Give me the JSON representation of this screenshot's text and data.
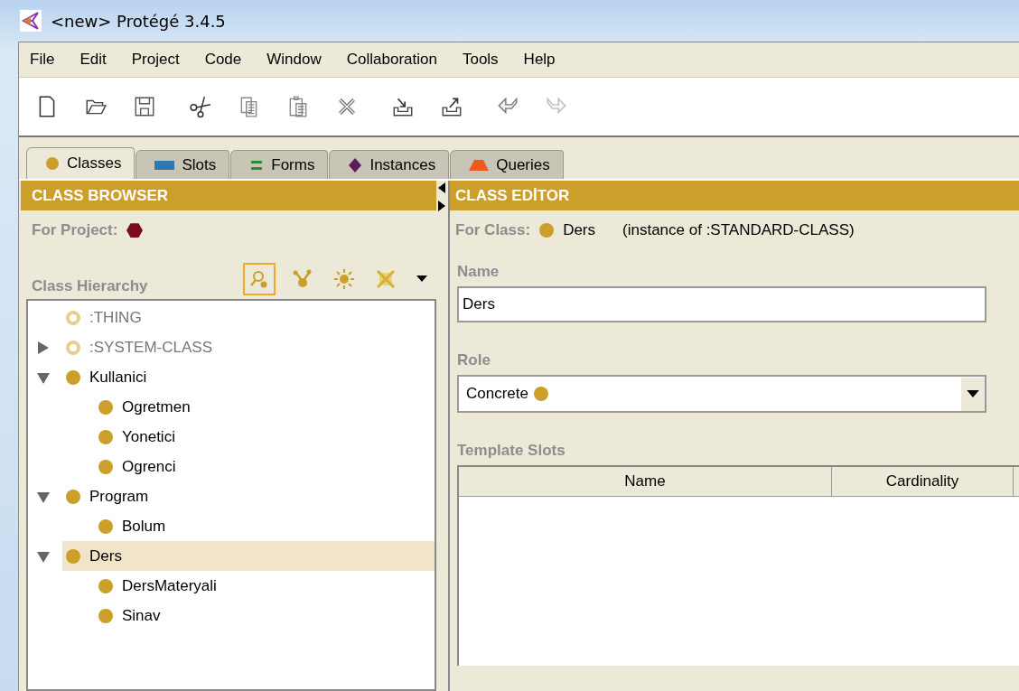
{
  "window": {
    "title": "<new>  Protégé 3.4.5"
  },
  "menu": [
    "File",
    "Edit",
    "Project",
    "Code",
    "Window",
    "Collaboration",
    "Tools",
    "Help"
  ],
  "tabs": [
    {
      "label": "Classes",
      "kind": "circle",
      "color": "#cc9e2a",
      "selected": true
    },
    {
      "label": "Slots",
      "kind": "bar",
      "color": "#2e78b0",
      "selected": false
    },
    {
      "label": "Forms",
      "kind": "lines",
      "color": "#2e8a2e",
      "selected": false
    },
    {
      "label": "Instances",
      "kind": "diamond",
      "color": "#5a1e5a",
      "selected": false
    },
    {
      "label": "Queries",
      "kind": "trapezoid",
      "color": "#ef5a1e",
      "selected": false
    }
  ],
  "class_browser": {
    "title": "CLASS BROWSER",
    "for_project_label": "For Project:",
    "hierarchy_label": "Class Hierarchy",
    "tree": [
      {
        "label": ":THING",
        "kind": "system",
        "selected": false
      },
      {
        "label": ":SYSTEM-CLASS",
        "kind": "system",
        "expanded": false,
        "selected": false
      },
      {
        "label": "Kullanici",
        "kind": "class",
        "expanded": true,
        "selected": false,
        "children": [
          {
            "label": "Ogretmen",
            "kind": "class",
            "selected": false
          },
          {
            "label": "Yonetici",
            "kind": "class",
            "selected": false
          },
          {
            "label": "Ogrenci",
            "kind": "class",
            "selected": false
          }
        ]
      },
      {
        "label": "Program",
        "kind": "class",
        "expanded": true,
        "selected": false,
        "children": [
          {
            "label": "Bolum",
            "kind": "class",
            "selected": false
          }
        ]
      },
      {
        "label": "Ders",
        "kind": "class",
        "expanded": true,
        "selected": true,
        "children": [
          {
            "label": "DersMateryali",
            "kind": "class",
            "selected": false
          },
          {
            "label": "Sinav",
            "kind": "class",
            "selected": false
          }
        ]
      }
    ]
  },
  "class_editor": {
    "title": "CLASS EDİTOR",
    "for_class_label": "For Class:",
    "class_name": "Ders",
    "instance_of": "(instance of :STANDARD-CLASS)",
    "name_label": "Name",
    "name_value": "Ders",
    "role_label": "Role",
    "role_value": "Concrete",
    "template_slots_label": "Template Slots",
    "columns": [
      "Name",
      "Cardinality"
    ]
  }
}
